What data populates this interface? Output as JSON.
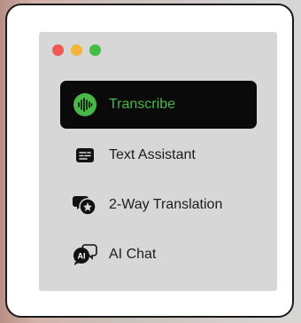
{
  "window": {
    "controls": [
      {
        "name": "close",
        "color": "#ef5a55"
      },
      {
        "name": "minimize",
        "color": "#f3b53a"
      },
      {
        "name": "zoom",
        "color": "#43bf48"
      }
    ]
  },
  "accent_color": "#49b849",
  "menu": {
    "items": [
      {
        "label": "Transcribe",
        "icon": "waveform-icon",
        "active": true
      },
      {
        "label": "Text Assistant",
        "icon": "text-lines-icon",
        "active": false
      },
      {
        "label": "2-Way Translation",
        "icon": "translation-icon",
        "active": false
      },
      {
        "label": "AI Chat",
        "icon": "ai-chat-icon",
        "active": false
      }
    ]
  }
}
